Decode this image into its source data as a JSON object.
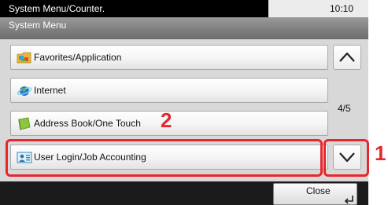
{
  "status_bar": {
    "title": "System Menu/Counter.",
    "time": "10:10"
  },
  "subtitle": "System Menu",
  "menu_items": [
    {
      "label": "Favorites/Application",
      "icon": "favorites-folder-icon"
    },
    {
      "label": "Internet",
      "icon": "internet-globe-icon"
    },
    {
      "label": "Address Book/One Touch",
      "icon": "address-book-icon"
    },
    {
      "label": "User Login/Job Accounting",
      "icon": "user-login-icon"
    }
  ],
  "page_indicator": "4/5",
  "close_label": "Close",
  "callouts": {
    "step_1": "1",
    "step_2": "2"
  },
  "colors": {
    "highlight": "#e8262b",
    "status_bar": "#000000",
    "subtitle_bar": "#8a8a8a"
  }
}
